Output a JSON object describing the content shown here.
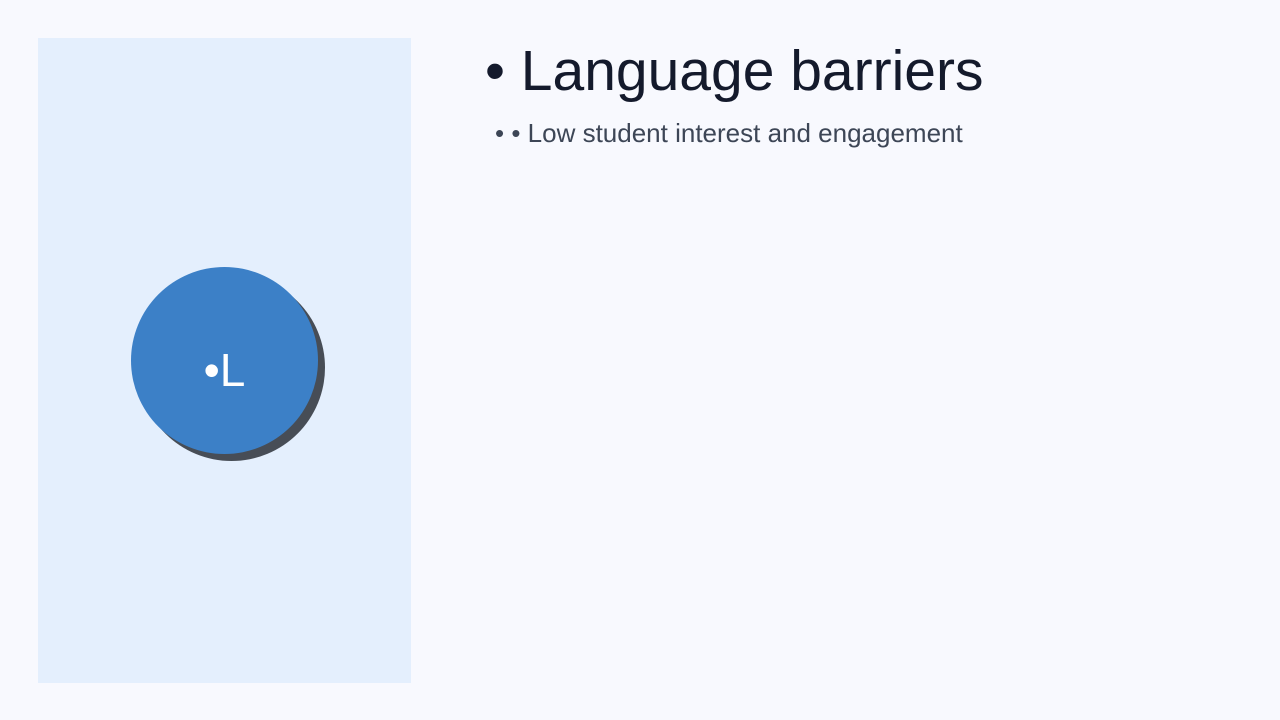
{
  "slide": {
    "title": "• Language barriers",
    "bullet": "• • Low student interest and engagement",
    "badge_text": "•L"
  },
  "colors": {
    "background": "#f8f9fe",
    "side_panel": "#e4effd",
    "circle": "#3c80c7",
    "circle_shadow": "#474d56",
    "title_text": "#141a2c",
    "bullet_text": "#3d4656"
  }
}
